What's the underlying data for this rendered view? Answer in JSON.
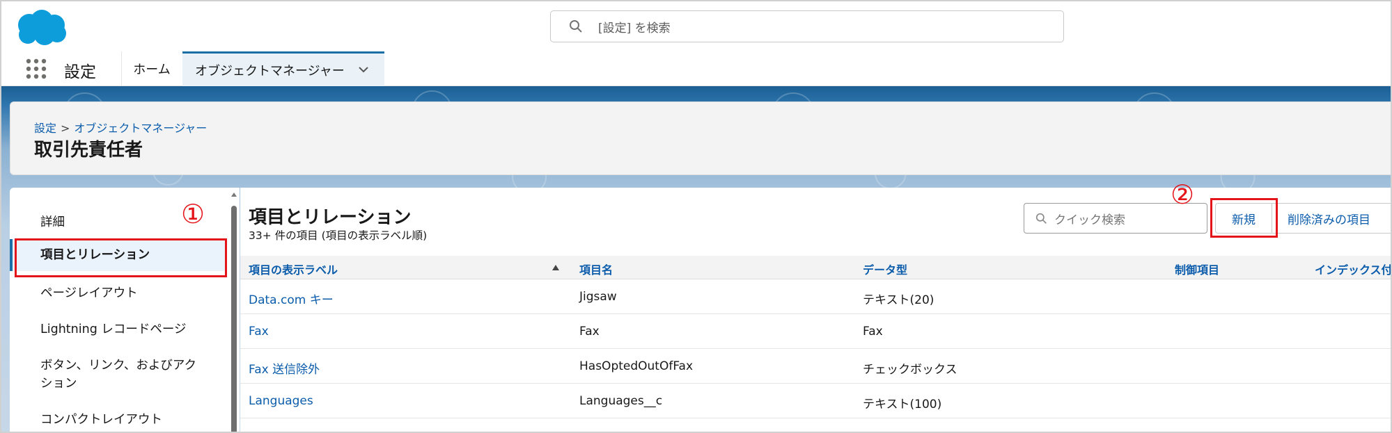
{
  "header": {
    "search_placeholder": "[設定] を検索"
  },
  "nav": {
    "app_name": "設定",
    "home_label": "ホーム",
    "active_tab_label": "オブジェクトマネージャー"
  },
  "page": {
    "breadcrumb_root": "設定",
    "breadcrumb_sep": ">",
    "breadcrumb_current": "オブジェクトマネージャー",
    "title": "取引先責任者"
  },
  "sidebar": {
    "items": [
      {
        "label": "詳細"
      },
      {
        "label": "項目とリレーション"
      },
      {
        "label": "ページレイアウト"
      },
      {
        "label": "Lightning レコードページ"
      },
      {
        "label": "ボタン、リンク、およびアク"
      },
      {
        "label": "ション"
      },
      {
        "label": "コンパクトレイアウト"
      }
    ]
  },
  "main": {
    "title": "項目とリレーション",
    "subtitle": "33+ 件の項目 (項目の表示ラベル順)",
    "quick_search_placeholder": "クイック検索",
    "new_button": "新規",
    "deleted_button": "削除済みの項目",
    "columns": [
      "項目の表示ラベル",
      "項目名",
      "データ型",
      "制御項目",
      "インデックス付"
    ],
    "rows": [
      {
        "label": "Data.com キー",
        "name": "Jigsaw",
        "type": "テキスト(20)"
      },
      {
        "label": "Fax",
        "name": "Fax",
        "type": "Fax"
      },
      {
        "label": "Fax 送信除外",
        "name": "HasOptedOutOfFax",
        "type": "チェックボックス"
      },
      {
        "label": "Languages",
        "name": "Languages__c",
        "type": "テキスト(100)"
      }
    ]
  },
  "annotations": {
    "step1": "①",
    "step2": "②"
  },
  "colors": {
    "link": "#0b5cab",
    "annotation_red": "#e4141b",
    "band_blue": "#1b5f93"
  }
}
